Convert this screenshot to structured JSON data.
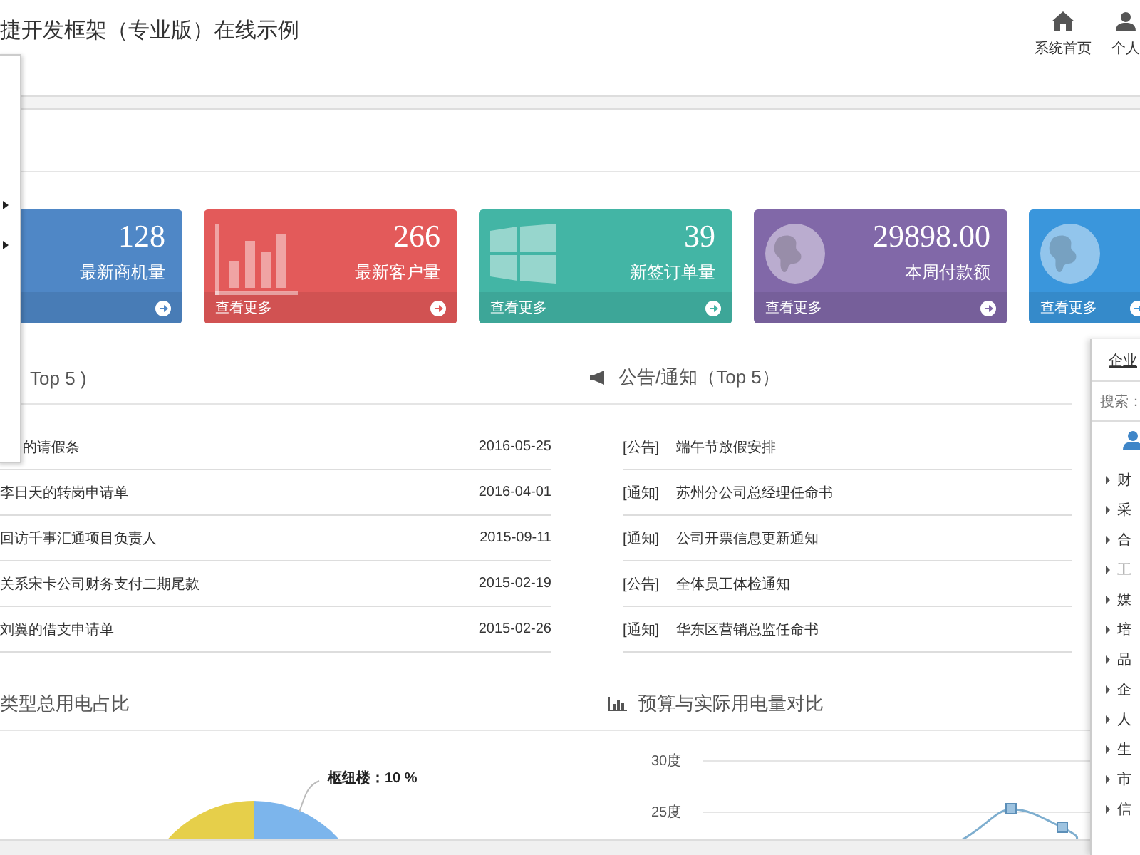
{
  "header": {
    "title": "捷开发框架（专业版）在线示例",
    "nav": [
      {
        "kind": "home",
        "label": "系统首页"
      },
      {
        "kind": "user",
        "label": "个人"
      }
    ]
  },
  "side_menu": {
    "items": [
      {
        "kind": "caret"
      },
      {
        "kind": "caret"
      }
    ]
  },
  "cards": [
    {
      "kind": "none",
      "value": "128",
      "label": "最新商机量",
      "color": "#4f87c6"
    },
    {
      "kind": "bars",
      "value": "266",
      "label": "最新客户量",
      "more": "查看更多",
      "color": "#e35a5a"
    },
    {
      "kind": "windows",
      "value": "39",
      "label": "新签订单量",
      "more": "查看更多",
      "color": "#43b5a5"
    },
    {
      "kind": "globe",
      "value": "29898.00",
      "label": "本周付款额",
      "more": "查看更多",
      "color": "#8168a8"
    },
    {
      "kind": "globe",
      "more": "查看更多",
      "color": "#3a96dc"
    }
  ],
  "tasks": {
    "title": "Top 5 )",
    "rows": [
      {
        "title": "的请假条",
        "date": "2016-05-25"
      },
      {
        "title": "李日天的转岗申请单",
        "date": "2016-04-01"
      },
      {
        "title": "回访千事汇通项目负责人",
        "date": "2015-09-11"
      },
      {
        "title": "关系宋卡公司财务支付二期尾款",
        "date": "2015-02-19"
      },
      {
        "title": "刘翼的借支申请单",
        "date": "2015-02-26"
      }
    ]
  },
  "notices": {
    "title": "公告/通知（Top 5）",
    "rows": [
      {
        "tag": "[公告]",
        "title": "端午节放假安排"
      },
      {
        "tag": "[通知]",
        "title": "苏州分公司总经理任命书"
      },
      {
        "tag": "[通知]",
        "title": "公司开票信息更新通知"
      },
      {
        "tag": "[公告]",
        "title": "全体员工体检通知"
      },
      {
        "tag": "[通知]",
        "title": "华东区营销总监任命书"
      }
    ]
  },
  "pie_panel": {
    "title": "类型总用电占比",
    "label": "枢纽楼：10 %"
  },
  "line_panel": {
    "title": "预算与实际用电量对比",
    "ticks": [
      "30度",
      "25度"
    ]
  },
  "org_panel": {
    "title": "企业",
    "search_label": "搜索：",
    "items": [
      "财",
      "采",
      "合",
      "工",
      "媒",
      "培",
      "品",
      "企",
      "人",
      "生",
      "市",
      "信"
    ]
  }
}
